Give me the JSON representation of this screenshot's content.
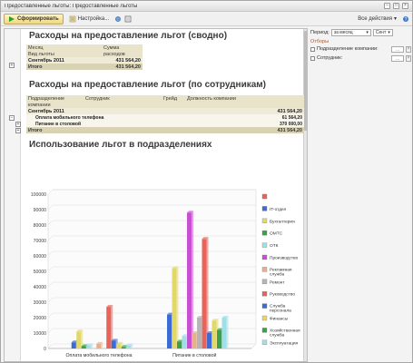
{
  "window": {
    "title": "Предоставленные льготы: Предоставленные льготы"
  },
  "toolbar": {
    "run_label": "Сформировать",
    "settings_label": "Настройка...",
    "all_actions_label": "Все действия"
  },
  "report": {
    "title_summary": "Расходы на предоставление льгот (сводно)",
    "summary_table": {
      "header": [
        "Месяц",
        "Сумма"
      ],
      "header2": [
        "Вид льготы",
        "расходов"
      ],
      "rows": [
        {
          "label": "Сентябрь 2011",
          "value": "431 564,20"
        },
        {
          "label": "Итого",
          "value": "431 564,20"
        }
      ]
    },
    "title_employees": "Расходы на предоставление льгот (по сотрудникам)",
    "employee_table": {
      "header_line1": [
        "Подразделение",
        "Сотрудник",
        "Грейд",
        "Должность компании"
      ],
      "header_line2": "компании",
      "month": {
        "label": "Сентябрь 2011",
        "value": "431 564,20"
      },
      "items": [
        {
          "label": "Оплата мобильного телефона",
          "value": "61 564,20"
        },
        {
          "label": "Питание в столовой",
          "value": "370 000,00"
        }
      ],
      "total": {
        "label": "Итого",
        "value": "431 564,20"
      }
    },
    "title_chart": "Использование льгот в подразделениях"
  },
  "settings": {
    "period_label": "Период:",
    "period_value": "за месяц",
    "period_month": "Сент",
    "filters_label": "Отборы",
    "filter1": "Подразделение компании:",
    "filter2": "Сотрудник:",
    "filter_value": "..."
  },
  "chart_data": {
    "type": "bar",
    "categories": [
      "Оплата мобильного телефона",
      "Питание в столовой"
    ],
    "yticks": [
      "0",
      "10000",
      "20000",
      "30000",
      "40000",
      "50000",
      "60000",
      "70000",
      "80000",
      "90000",
      "100000"
    ],
    "ylim": [
      0,
      100000
    ],
    "legend_placement": "right",
    "series": [
      {
        "name": "",
        "color": "#e8635a",
        "values": [
          0,
          0
        ]
      },
      {
        "name": "IT-отдел",
        "color": "#3d6bd6",
        "values": [
          4000,
          22000
        ]
      },
      {
        "name": "Бухгалтерия",
        "color": "#e2d86a",
        "values": [
          11000,
          52000
        ]
      },
      {
        "name": "ОМТС",
        "color": "#3aa04a",
        "values": [
          1500,
          4500
        ]
      },
      {
        "name": "ОТК",
        "color": "#9fe0e8",
        "values": [
          2000,
          8000
        ]
      },
      {
        "name": "Производство",
        "color": "#c84fd2",
        "values": [
          0,
          88000
        ]
      },
      {
        "name": "Рекламная служба",
        "color": "#e8b08a",
        "values": [
          3000,
          10000
        ]
      },
      {
        "name": "Ремонт",
        "color": "#b5b5b5",
        "values": [
          0,
          20000
        ]
      },
      {
        "name": "Руководство",
        "color": "#e8635a",
        "values": [
          27000,
          71000
        ]
      },
      {
        "name": "Служба персонала",
        "color": "#3d6bd6",
        "values": [
          5000,
          10000
        ]
      },
      {
        "name": "Финансы",
        "color": "#e2d86a",
        "values": [
          3000,
          18000
        ]
      },
      {
        "name": "Хозяйственная служба",
        "color": "#3aa04a",
        "values": [
          1000,
          12000
        ]
      },
      {
        "name": "Эксплуатация",
        "color": "#9fe0e8",
        "values": [
          2000,
          20000
        ]
      }
    ]
  }
}
